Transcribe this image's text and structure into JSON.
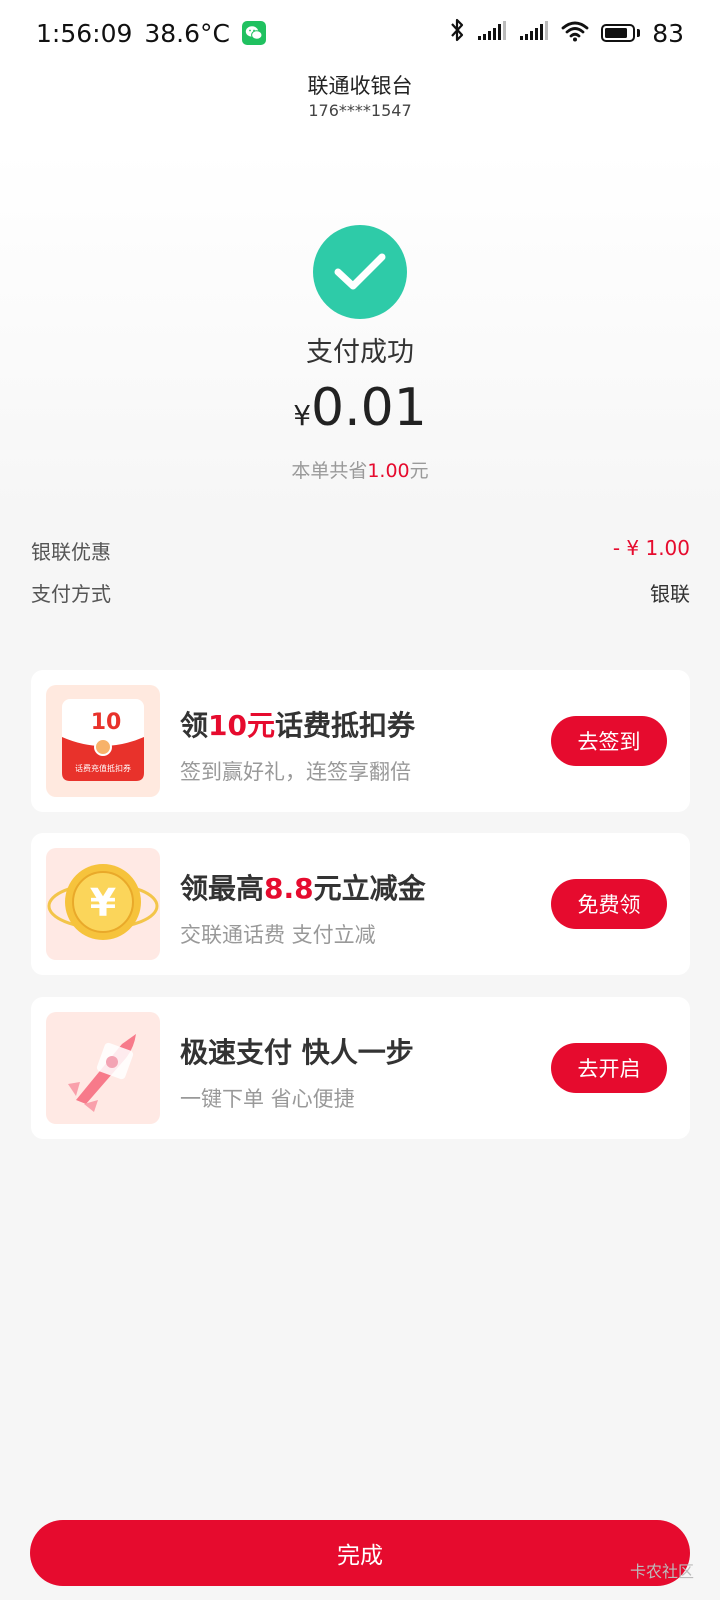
{
  "status_bar": {
    "time": "1:56:09",
    "temperature": "38.6°C",
    "battery_level": "83",
    "battery_percent": 83,
    "icons": [
      "wechat-icon",
      "bluetooth-icon",
      "signal-icon",
      "signal-icon",
      "wifi-icon",
      "battery-icon"
    ]
  },
  "header": {
    "title": "联通收银台",
    "phone": "176****1547"
  },
  "result": {
    "status_text": "支付成功",
    "currency": "¥",
    "amount": "0.01",
    "saved_prefix": "本单共省",
    "saved_amount": "1.00",
    "saved_suffix": "元"
  },
  "details": [
    {
      "label": "银联优惠",
      "value": "- ¥ 1.00"
    },
    {
      "label": "支付方式",
      "value": "银联"
    }
  ],
  "promos": [
    {
      "title_pre": "领",
      "title_hl": "10元",
      "title_post": "话费抵扣券",
      "subtitle": "签到赢好礼，连签享翻倍",
      "button": "去签到",
      "thumb_text": "10",
      "thumb_caption": "话费充值抵扣券",
      "thumb_icon": "coupon-envelope-icon"
    },
    {
      "title_pre": "领最高",
      "title_hl": "8.8",
      "title_post": "元立减金",
      "subtitle": "交联通话费 支付立减",
      "button": "免费领",
      "thumb_text": "¥",
      "thumb_icon": "gold-coin-icon"
    },
    {
      "title_pre": "极速支付 快人一步",
      "title_hl": "",
      "title_post": "",
      "subtitle": "一键下单 省心便捷",
      "button": "去开启",
      "thumb_icon": "rocket-icon"
    }
  ],
  "footer": {
    "done_label": "完成",
    "watermark": "卡农社区"
  },
  "colors": {
    "accent": "#e60b2e",
    "success": "#2ecba8",
    "wechat": "#20c160"
  }
}
